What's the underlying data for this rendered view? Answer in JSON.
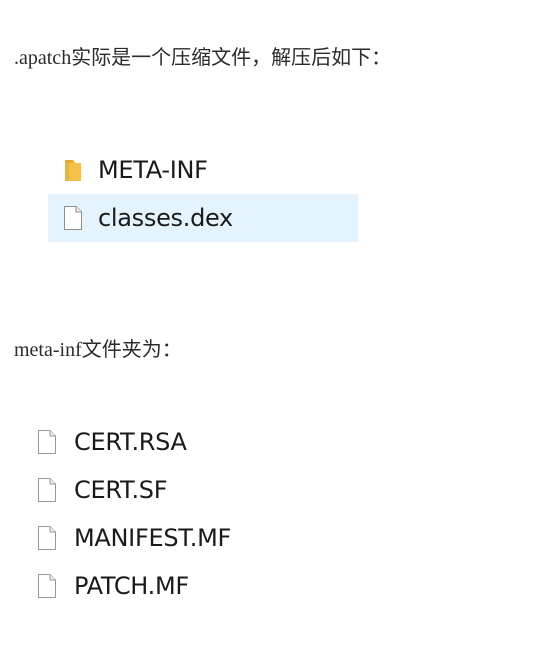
{
  "intro_text": ".apatch实际是一个压缩文件，解压后如下：",
  "archive_listing": {
    "items": [
      {
        "name": "META-INF",
        "icon": "folder-icon",
        "selected": false
      },
      {
        "name": "classes.dex",
        "icon": "file-icon",
        "selected": true
      }
    ]
  },
  "meta_inf_text": "meta-inf文件夹为：",
  "meta_inf_listing": {
    "items": [
      {
        "name": "CERT.RSA",
        "icon": "file-icon"
      },
      {
        "name": "CERT.SF",
        "icon": "file-icon"
      },
      {
        "name": "MANIFEST.MF",
        "icon": "file-icon"
      },
      {
        "name": "PATCH.MF",
        "icon": "file-icon"
      }
    ]
  },
  "colors": {
    "selection_bg": "#e5f3ff",
    "folder": "#f5c64d",
    "file_outline": "#9a9a9a"
  }
}
